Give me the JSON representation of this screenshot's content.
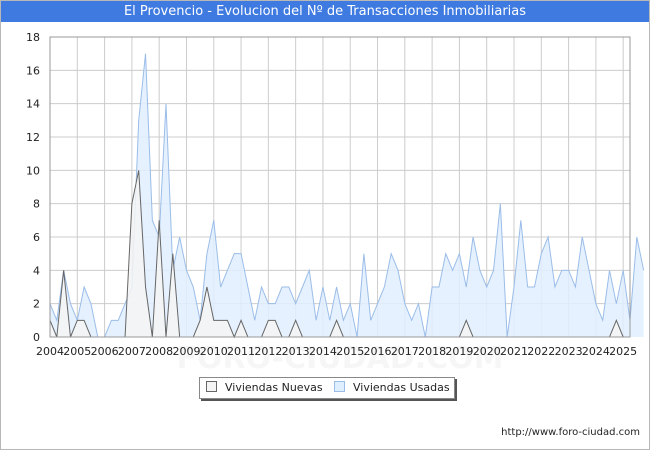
{
  "title": "El Provencio - Evolucion del Nº de Transacciones Inmobiliarias",
  "source": "http://www.foro-ciudad.com",
  "watermark": "FORO-CIUDAD.COM",
  "colors": {
    "title_bg": "#3e7ae0",
    "nuevas_line": "#666666",
    "nuevas_fill": "#f4f4f4",
    "usadas_line": "#9bbde8",
    "usadas_fill": "#e0efff",
    "grid": "#cccccc"
  },
  "chart_data": {
    "type": "area",
    "title": "El Provencio - Evolucion del Nº de Transacciones Inmobiliarias",
    "xlabel": "",
    "ylabel": "",
    "ylim": [
      0,
      18
    ],
    "y_ticks": [
      0,
      2,
      4,
      6,
      8,
      10,
      12,
      14,
      16,
      18
    ],
    "x_tick_labels": [
      "2004",
      "2005",
      "2006",
      "2007",
      "2008",
      "2009",
      "2010",
      "2011",
      "2012",
      "2013",
      "2014",
      "2015",
      "2016",
      "2017",
      "2018",
      "2019",
      "2020",
      "2021",
      "2022",
      "2023",
      "2024",
      "2025"
    ],
    "x_range": [
      2004,
      2025.25
    ],
    "frequency": "quarterly",
    "grid": true,
    "legend_position": "bottom",
    "series": [
      {
        "name": "Viviendas Nuevas",
        "values": [
          1,
          0,
          4,
          0,
          1,
          1,
          0,
          0,
          0,
          0,
          0,
          0,
          8,
          10,
          3,
          0,
          7,
          0,
          5,
          0,
          0,
          0,
          1,
          3,
          1,
          1,
          1,
          0,
          1,
          0,
          0,
          0,
          1,
          1,
          0,
          0,
          1,
          0,
          0,
          0,
          0,
          0,
          1,
          0,
          0,
          0,
          0,
          0,
          0,
          0,
          0,
          0,
          0,
          0,
          0,
          0,
          0,
          0,
          0,
          0,
          0,
          1,
          0,
          0,
          0,
          0,
          0,
          0,
          0,
          0,
          0,
          0,
          0,
          0,
          0,
          0,
          0,
          0,
          0,
          0,
          0,
          0,
          0,
          1,
          0
        ]
      },
      {
        "name": "Viviendas Usadas",
        "values": [
          2,
          1,
          4,
          2,
          1,
          3,
          2,
          0,
          0,
          1,
          1,
          2,
          3,
          13,
          17,
          7,
          6,
          14,
          4,
          6,
          4,
          3,
          1,
          5,
          7,
          3,
          4,
          5,
          5,
          3,
          1,
          3,
          2,
          2,
          3,
          3,
          2,
          3,
          4,
          1,
          3,
          1,
          3,
          1,
          2,
          0,
          5,
          1,
          2,
          3,
          5,
          4,
          2,
          1,
          2,
          0,
          3,
          3,
          5,
          4,
          5,
          3,
          6,
          4,
          3,
          4,
          8,
          0,
          3,
          7,
          3,
          3,
          5,
          6,
          3,
          4,
          4,
          3,
          6,
          4,
          2,
          1,
          4,
          2,
          4,
          1,
          6,
          4
        ]
      }
    ]
  },
  "legend": {
    "nuevas": "Viviendas Nuevas",
    "usadas": "Viviendas Usadas"
  }
}
